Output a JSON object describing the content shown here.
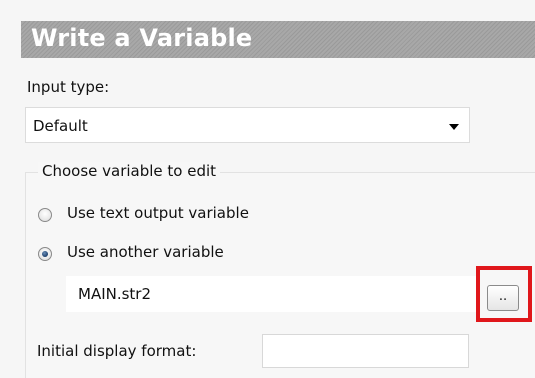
{
  "dialog": {
    "title": "Write a Variable",
    "input_type_label": "Input type:",
    "input_type_value": "Default",
    "group_label": "Choose variable to edit",
    "options": [
      {
        "label": "Use text output variable",
        "checked": false
      },
      {
        "label": "Use another variable",
        "checked": true
      }
    ],
    "variable_value": "MAIN.str2",
    "browse_label": "..",
    "display_format_label": "Initial display format:",
    "display_format_value": ""
  },
  "colors": {
    "highlight": "#e0171b",
    "title_bg": "#a0a0a0",
    "title_text": "#ffffff"
  }
}
